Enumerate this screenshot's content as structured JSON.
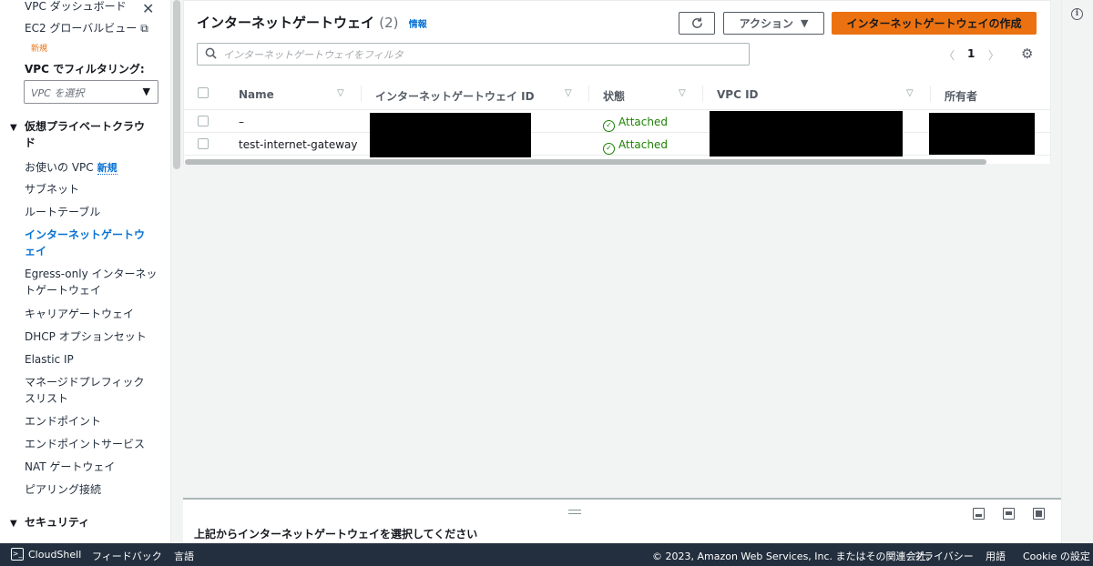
{
  "sidebar": {
    "items": [
      {
        "label": "VPC ダッシュボード"
      },
      {
        "label": "EC2 グローバルビュー"
      },
      {
        "label": "お使いの VPC"
      },
      {
        "label": "サブネット"
      },
      {
        "label": "ルートテーブル"
      },
      {
        "label": "インターネットゲートウ"
      },
      {
        "label": "ェイ"
      },
      {
        "label": "Egress-only インターネッ"
      },
      {
        "label": "トゲートウェイ"
      },
      {
        "label": "キャリアゲートウェイ"
      },
      {
        "label": "DHCP オプションセット"
      },
      {
        "label": "Elastic IP"
      },
      {
        "label": "マネージドプレフィック"
      },
      {
        "label": "スリスト"
      },
      {
        "label": "エンドポイント"
      },
      {
        "label": "エンドポイントサービス"
      },
      {
        "label": "NAT ゲートウェイ"
      },
      {
        "label": "ピアリング接続"
      }
    ],
    "new_badge": "新規",
    "new_badge_2": "新規",
    "filter_label": "VPC でフィルタリング:",
    "filter_placeholder": "VPC を選択",
    "section_vpc": "仮想プライベートクラウ",
    "section_vpc_2": "ド",
    "section_security": "セキュリティ"
  },
  "header": {
    "title": "インターネットゲートウェイ",
    "count": "(2)",
    "info": "情報",
    "actions_label": "アクション",
    "create_label": "インターネットゲートウェイの作成"
  },
  "search": {
    "placeholder": "インターネットゲートウェイをフィルタ",
    "value": ""
  },
  "pagination": {
    "page": "1"
  },
  "table": {
    "columns": [
      "Name",
      "インターネットゲートウェイ ID",
      "状態",
      "VPC ID",
      "所有者"
    ],
    "rows": [
      {
        "name": "–",
        "state": "Attached"
      },
      {
        "name": "test-internet-gateway",
        "state": "Attached"
      }
    ]
  },
  "split_panel": {
    "title": "上記からインターネットゲートウェイを選択してください"
  },
  "footer": {
    "cloudshell": "CloudShell",
    "feedback": "フィードバック",
    "language": "言語",
    "copyright": "© 2023, Amazon Web Services, Inc. またはその関連会社。",
    "privacy": "プライバシー",
    "terms": "用語",
    "cookie": "Cookie の設定"
  },
  "colors": {
    "accent": "#0972d3",
    "primary_button": "#ec7211",
    "status_ok": "#1d8102",
    "footer_bg": "#232f3e"
  }
}
